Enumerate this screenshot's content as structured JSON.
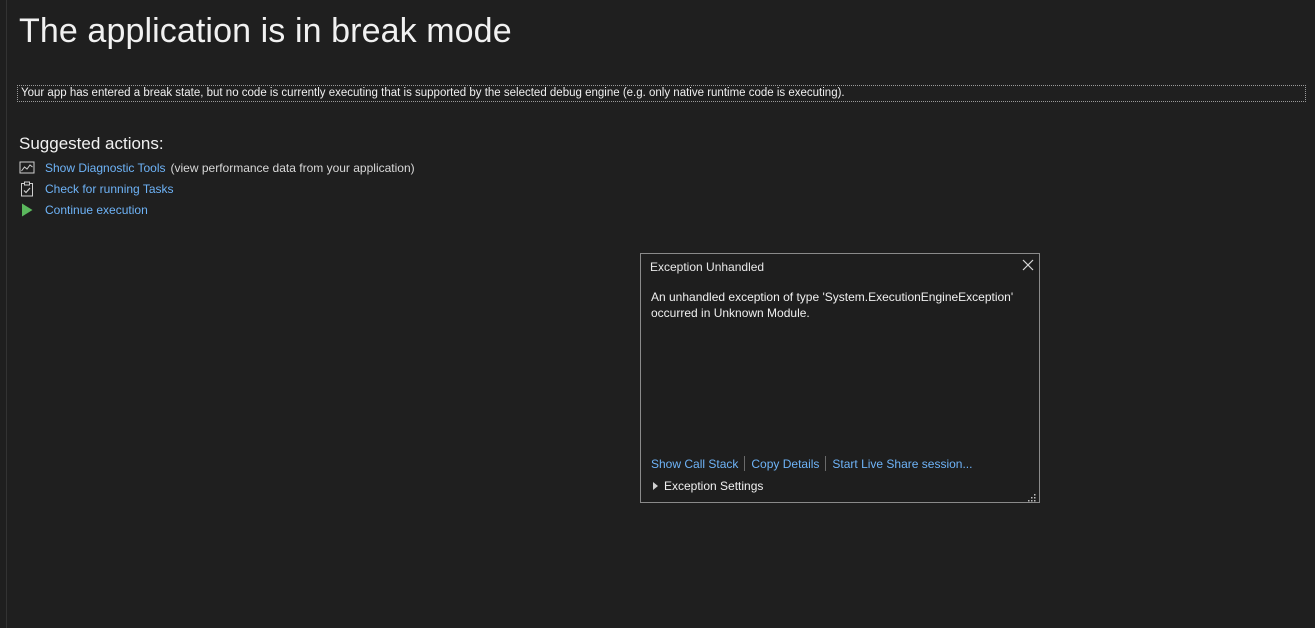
{
  "page": {
    "title": "The application is in break mode",
    "info_message": "Your app has entered a break state, but no code is currently executing that is supported by the selected debug engine (e.g. only native runtime code is executing).",
    "suggested_heading": "Suggested actions:"
  },
  "actions": [
    {
      "icon": "chart-icon",
      "label": "Show Diagnostic Tools",
      "description": "(view performance data from your application)"
    },
    {
      "icon": "clipboard-check-icon",
      "label": "Check for running Tasks",
      "description": ""
    },
    {
      "icon": "play-icon",
      "label": "Continue execution",
      "description": ""
    }
  ],
  "exception_popup": {
    "title": "Exception Unhandled",
    "message_line1": "An unhandled exception of type 'System.ExecutionEngineException'",
    "message_line2": "occurred in Unknown Module.",
    "links": {
      "call_stack": "Show Call Stack",
      "copy_details": "Copy Details",
      "live_share": "Start Live Share session..."
    },
    "settings_label": "Exception Settings"
  },
  "colors": {
    "background": "#1f1f1f",
    "link": "#6eb3f7",
    "play_green": "#5bb85d"
  }
}
